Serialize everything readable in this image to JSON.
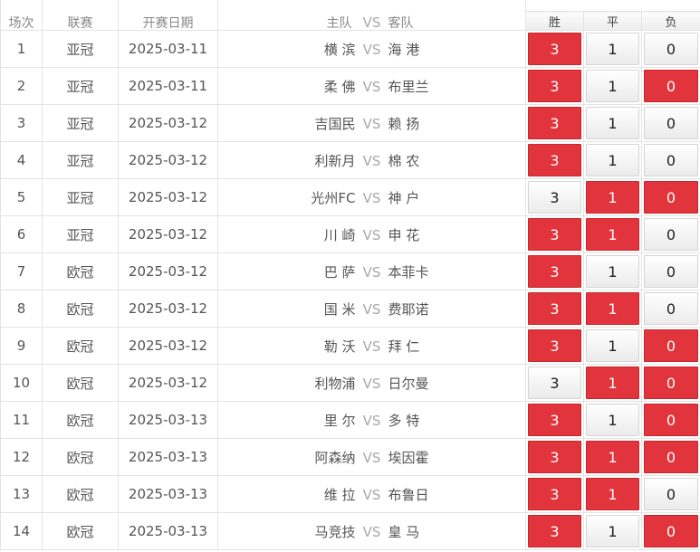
{
  "headers": {
    "no": "场次",
    "league": "联赛",
    "date": "开赛日期",
    "home": "主队",
    "vs": "VS",
    "away": "客队",
    "win": "胜",
    "draw": "平",
    "lose": "负"
  },
  "colors": {
    "selected": "#e2343c",
    "normal": "#f2f2f2"
  },
  "rows": [
    {
      "no": "1",
      "league": "亚冠",
      "date": "2025-03-11",
      "home": "横 滨",
      "vs": "VS",
      "away": "海 港",
      "win": "3",
      "draw": "1",
      "lose": "0",
      "sel": [
        true,
        false,
        false
      ]
    },
    {
      "no": "2",
      "league": "亚冠",
      "date": "2025-03-11",
      "home": "柔 佛",
      "vs": "VS",
      "away": "布里兰",
      "win": "3",
      "draw": "1",
      "lose": "0",
      "sel": [
        true,
        false,
        true
      ]
    },
    {
      "no": "3",
      "league": "亚冠",
      "date": "2025-03-12",
      "home": "吉国民",
      "vs": "VS",
      "away": "赖 扬",
      "win": "3",
      "draw": "1",
      "lose": "0",
      "sel": [
        true,
        false,
        false
      ]
    },
    {
      "no": "4",
      "league": "亚冠",
      "date": "2025-03-12",
      "home": "利新月",
      "vs": "VS",
      "away": "棉 农",
      "win": "3",
      "draw": "1",
      "lose": "0",
      "sel": [
        true,
        false,
        false
      ]
    },
    {
      "no": "5",
      "league": "亚冠",
      "date": "2025-03-12",
      "home": "光州FC",
      "vs": "VS",
      "away": "神 户",
      "win": "3",
      "draw": "1",
      "lose": "0",
      "sel": [
        false,
        true,
        true
      ]
    },
    {
      "no": "6",
      "league": "亚冠",
      "date": "2025-03-12",
      "home": "川 崎",
      "vs": "VS",
      "away": "申 花",
      "win": "3",
      "draw": "1",
      "lose": "0",
      "sel": [
        true,
        true,
        false
      ]
    },
    {
      "no": "7",
      "league": "欧冠",
      "date": "2025-03-12",
      "home": "巴 萨",
      "vs": "VS",
      "away": "本菲卡",
      "win": "3",
      "draw": "1",
      "lose": "0",
      "sel": [
        true,
        false,
        false
      ]
    },
    {
      "no": "8",
      "league": "欧冠",
      "date": "2025-03-12",
      "home": "国 米",
      "vs": "VS",
      "away": "费耶诺",
      "win": "3",
      "draw": "1",
      "lose": "0",
      "sel": [
        true,
        true,
        false
      ]
    },
    {
      "no": "9",
      "league": "欧冠",
      "date": "2025-03-12",
      "home": "勒 沃",
      "vs": "VS",
      "away": "拜 仁",
      "win": "3",
      "draw": "1",
      "lose": "0",
      "sel": [
        true,
        false,
        true
      ]
    },
    {
      "no": "10",
      "league": "欧冠",
      "date": "2025-03-12",
      "home": "利物浦",
      "vs": "VS",
      "away": "日尔曼",
      "win": "3",
      "draw": "1",
      "lose": "0",
      "sel": [
        false,
        true,
        true
      ]
    },
    {
      "no": "11",
      "league": "欧冠",
      "date": "2025-03-13",
      "home": "里 尔",
      "vs": "VS",
      "away": "多 特",
      "win": "3",
      "draw": "1",
      "lose": "0",
      "sel": [
        true,
        false,
        true
      ]
    },
    {
      "no": "12",
      "league": "欧冠",
      "date": "2025-03-13",
      "home": "阿森纳",
      "vs": "VS",
      "away": "埃因霍",
      "win": "3",
      "draw": "1",
      "lose": "0",
      "sel": [
        true,
        true,
        true
      ]
    },
    {
      "no": "13",
      "league": "欧冠",
      "date": "2025-03-13",
      "home": "维 拉",
      "vs": "VS",
      "away": "布鲁日",
      "win": "3",
      "draw": "1",
      "lose": "0",
      "sel": [
        true,
        true,
        false
      ]
    },
    {
      "no": "14",
      "league": "欧冠",
      "date": "2025-03-13",
      "home": "马竞技",
      "vs": "VS",
      "away": "皇 马",
      "win": "3",
      "draw": "1",
      "lose": "0",
      "sel": [
        true,
        false,
        true
      ]
    }
  ]
}
